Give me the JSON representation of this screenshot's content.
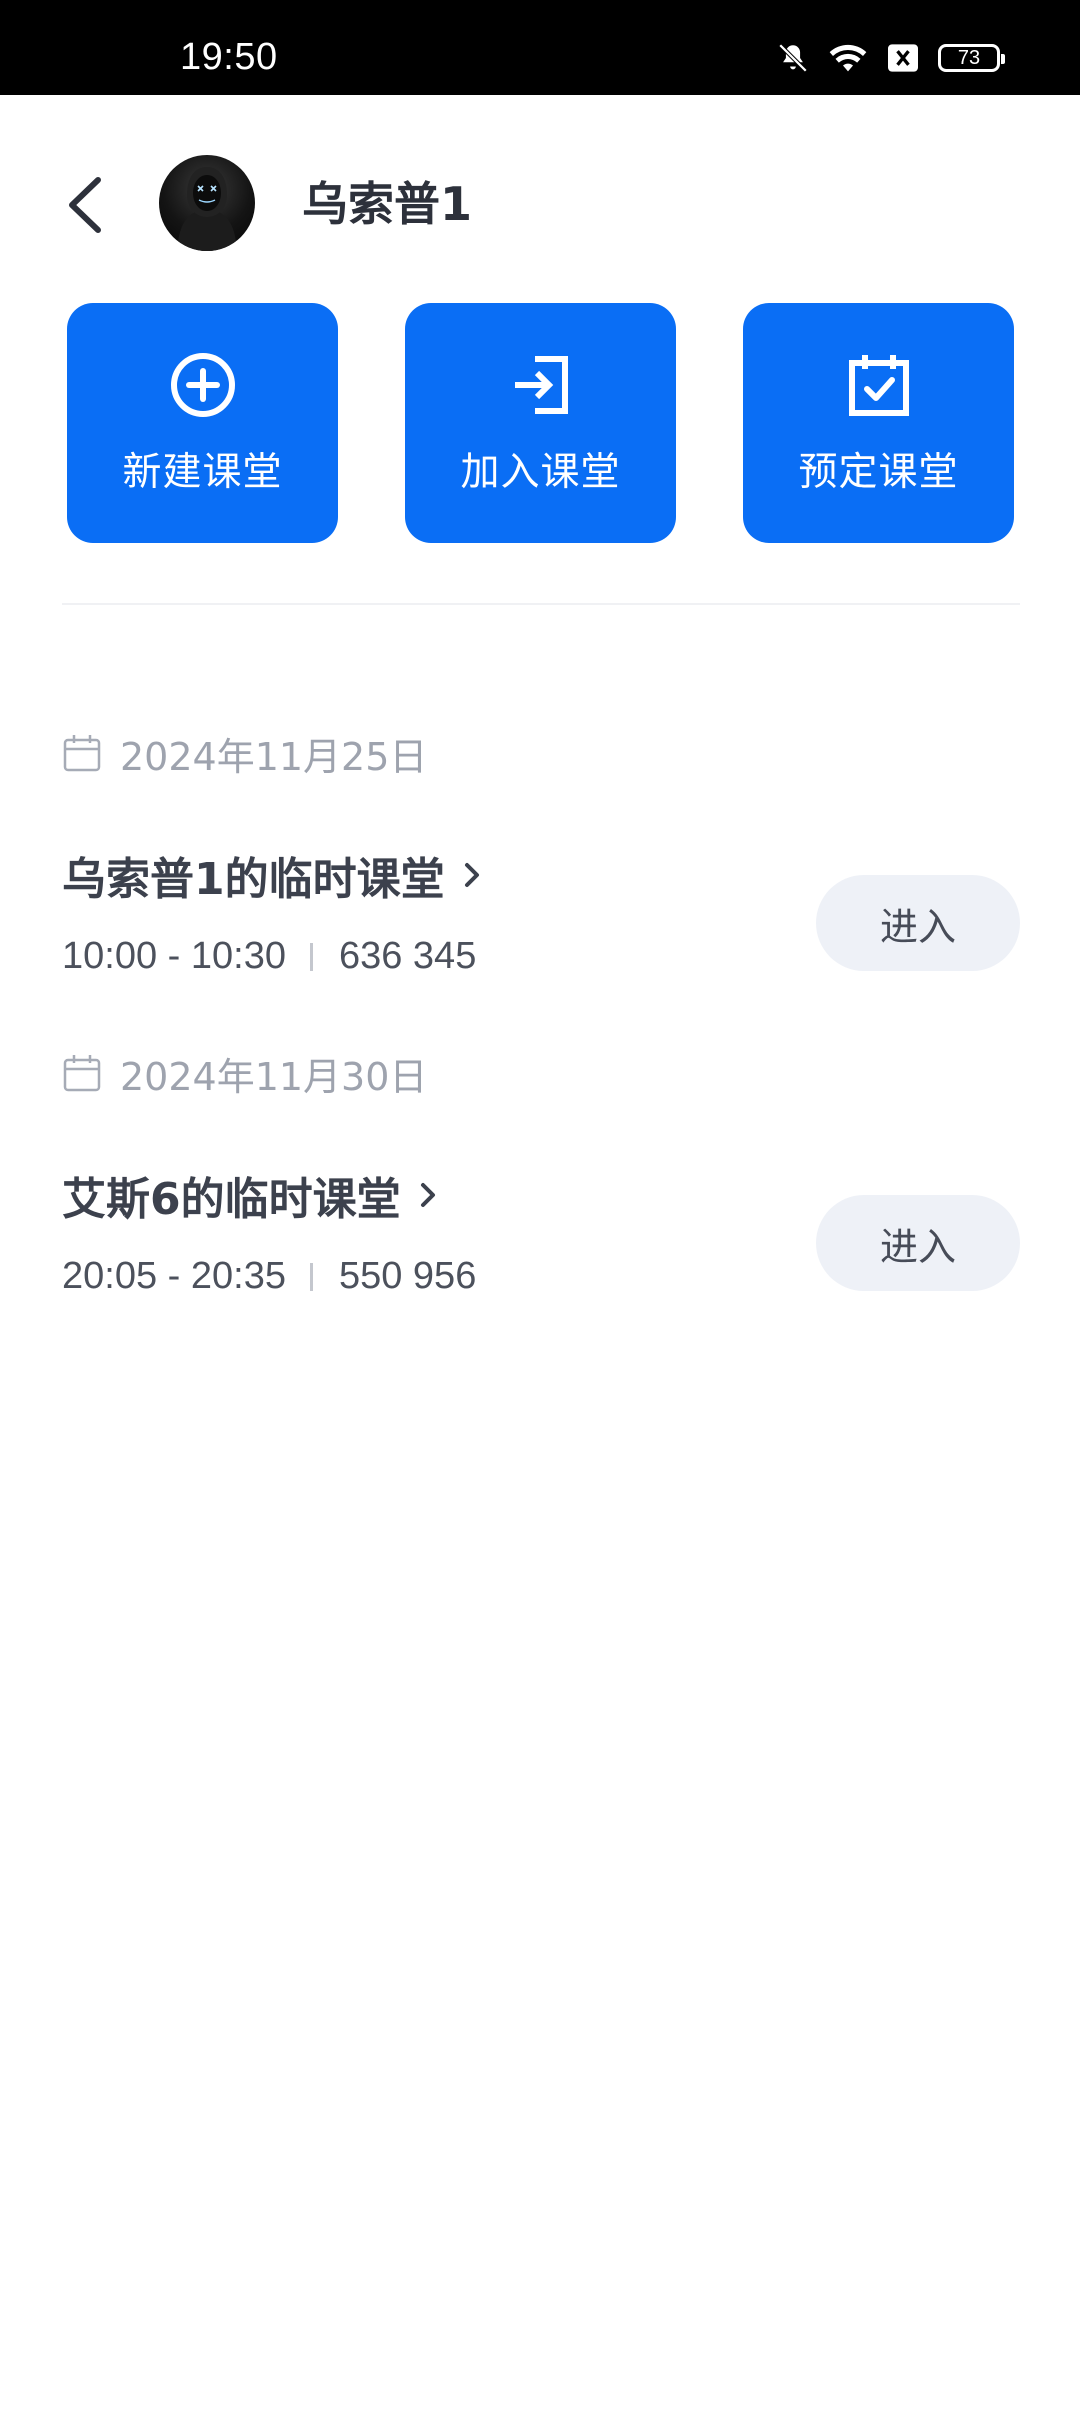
{
  "status_bar": {
    "time": "19:50",
    "battery": "73",
    "icons": [
      "bell-muted-icon",
      "wifi-icon",
      "sim-blocked-icon",
      "battery-icon"
    ]
  },
  "header": {
    "back_icon": "chevron-left-icon",
    "user_name": "乌索普1"
  },
  "actions": [
    {
      "label": "新建课堂",
      "icon": "plus-circle-icon"
    },
    {
      "label": "加入课堂",
      "icon": "login-icon"
    },
    {
      "label": "预定课堂",
      "icon": "calendar-check-icon"
    }
  ],
  "accent_color": "#0a6ef5",
  "schedule": [
    {
      "date": "2024年11月25日",
      "title": "乌索普1的临时课堂",
      "time": "10:00 - 10:30",
      "code": "636 345",
      "enter_label": "进入"
    },
    {
      "date": "2024年11月30日",
      "title": "艾斯6的临时课堂",
      "time": "20:05 - 20:35",
      "code": "550 956",
      "enter_label": "进入"
    }
  ]
}
